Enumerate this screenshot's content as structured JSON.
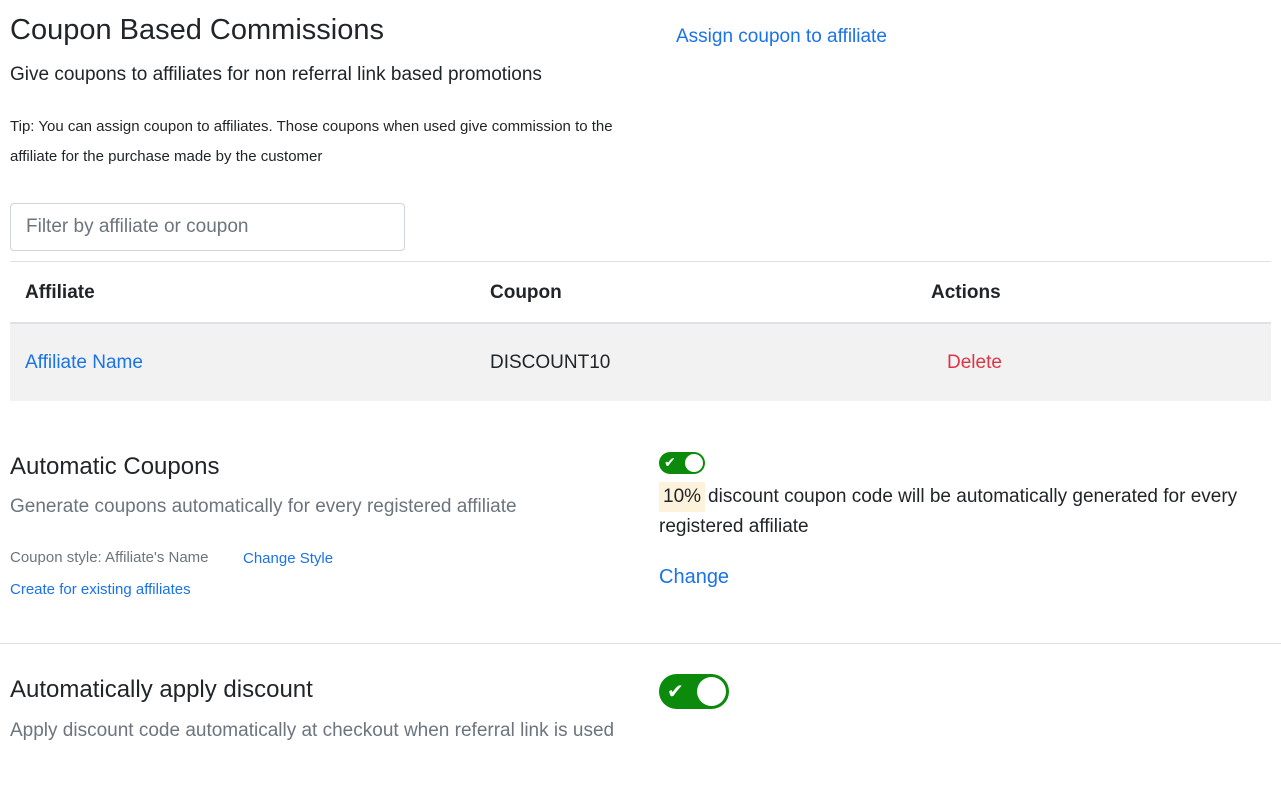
{
  "header": {
    "title": "Coupon Based Commissions",
    "subtitle": "Give coupons to affiliates for non referral link based promotions",
    "assign_link": "Assign coupon to affiliate",
    "tip": "Tip: You can assign coupon to affiliates. Those coupons when used give commission to the affiliate for the purchase made by the customer"
  },
  "filter": {
    "placeholder": "Filter by affiliate or coupon",
    "value": ""
  },
  "table": {
    "columns": [
      "Affiliate",
      "Coupon",
      "Actions"
    ],
    "rows": [
      {
        "affiliate": "Affiliate Name",
        "coupon": "DISCOUNT10",
        "action": "Delete"
      }
    ]
  },
  "automatic_coupons": {
    "title": "Automatic Coupons",
    "description": "Generate coupons automatically for every registered affiliate",
    "coupon_style": "Coupon style: Affiliate's Name",
    "change_style": "Change Style",
    "create_existing": "Create for existing affiliates",
    "toggle_on": true,
    "discount_value": "10%",
    "discount_text": "discount coupon code will be automatically generated for every registered affiliate",
    "change_link": "Change"
  },
  "auto_apply": {
    "title": "Automatically apply discount",
    "description": "Apply discount code automatically at checkout when referral link is used",
    "toggle_on": true
  },
  "icons": {
    "toggle_check": "check-icon"
  },
  "colors": {
    "link": "#1a73e8",
    "danger": "#dc3545",
    "toggle_on": "#0b8a0b",
    "row_bg": "#f2f2f2",
    "badge_bg": "#fdf3dc"
  }
}
